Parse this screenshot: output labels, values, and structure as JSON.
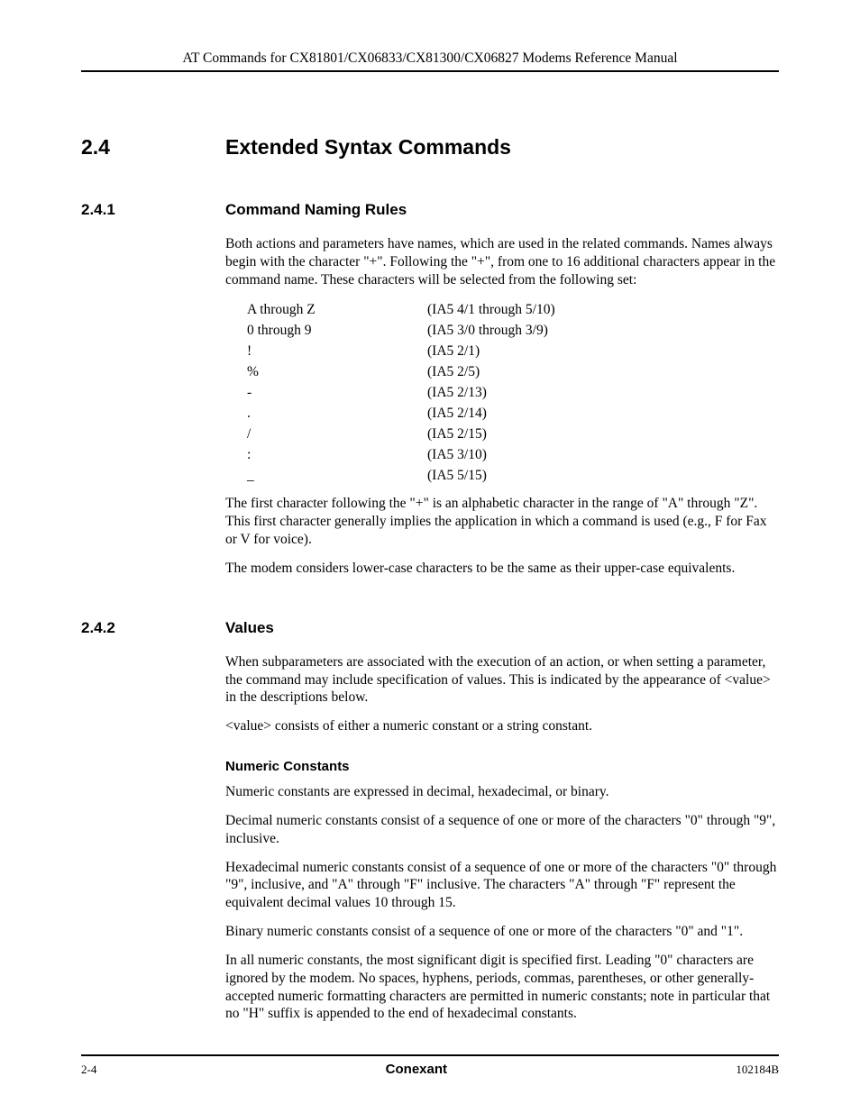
{
  "header": "AT Commands for CX81801/CX06833/CX81300/CX06827 Modems Reference Manual",
  "section": {
    "num": "2.4",
    "title": "Extended Syntax Commands"
  },
  "sub1": {
    "num": "2.4.1",
    "title": "Command Naming Rules",
    "para1": "Both actions and parameters have names, which are used in the related commands. Names always begin with the character \"+\". Following the \"+\", from one to 16 additional characters appear in the command name. These characters will be selected from the following set:",
    "rows": [
      {
        "c": "A through Z",
        "i": "(IA5 4/1 through 5/10)"
      },
      {
        "c": "0 through 9",
        "i": "(IA5 3/0 through 3/9)"
      },
      {
        "c": "!",
        "i": "(IA5 2/1)"
      },
      {
        "c": "%",
        "i": "(IA5 2/5)"
      },
      {
        "c": "-",
        "i": "(IA5 2/13)"
      },
      {
        "c": ".",
        "i": "(IA5 2/14)"
      },
      {
        "c": "/",
        "i": "(IA5 2/15)"
      },
      {
        "c": ":",
        "i": "(IA5 3/10)"
      },
      {
        "c": "_",
        "i": "(IA5 5/15)"
      }
    ],
    "para2": "The first character following the \"+\" is an alphabetic character in the range of \"A\" through \"Z\". This first character generally implies the application in which a command is used (e.g., F for Fax or V for voice).",
    "para3": "The modem considers lower-case characters to be the same as their upper-case equivalents."
  },
  "sub2": {
    "num": "2.4.2",
    "title": "Values",
    "para1": "When subparameters are associated with the execution of an action, or when setting a parameter, the command may include specification of values. This is indicated by the appearance of <value> in the descriptions below.",
    "para2": "<value> consists of either a numeric constant or a string constant.",
    "h3": "Numeric Constants",
    "para3": "Numeric constants are expressed in decimal, hexadecimal, or binary.",
    "para4": "Decimal numeric constants consist of a sequence of one or more of the characters \"0\" through \"9\", inclusive.",
    "para5": "Hexadecimal numeric constants consist of a sequence of one or more of the characters \"0\" through \"9\", inclusive, and \"A\" through \"F\" inclusive. The characters \"A\" through \"F\" represent the equivalent decimal values 10 through 15.",
    "para6": "Binary numeric constants consist of a sequence of one or more of the characters \"0\" and \"1\".",
    "para7": "In all numeric constants, the most significant digit is specified first. Leading \"0\" characters are ignored by the modem. No spaces, hyphens, periods, commas, parentheses, or other generally-accepted numeric formatting characters are permitted in numeric constants; note in particular that no \"H\" suffix is appended to the end of hexadecimal constants."
  },
  "footer": {
    "left": "2-4",
    "center": "Conexant",
    "right": "102184B"
  }
}
